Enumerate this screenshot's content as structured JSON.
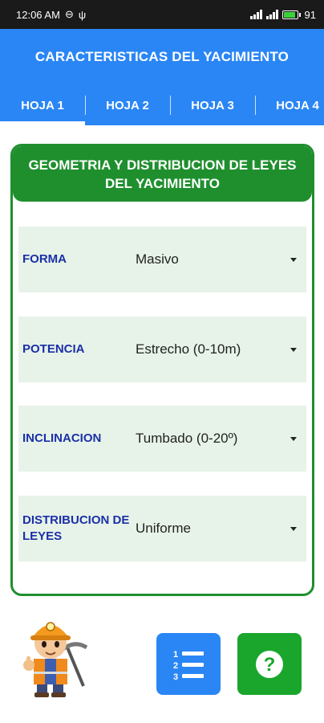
{
  "status_bar": {
    "time": "12:06 AM",
    "battery": "91"
  },
  "app_bar": {
    "title": "CARACTERISTICAS DEL YACIMIENTO"
  },
  "tabs": [
    {
      "label": "HOJA 1",
      "active": true
    },
    {
      "label": "HOJA 2",
      "active": false
    },
    {
      "label": "HOJA 3",
      "active": false
    },
    {
      "label": "HOJA 4",
      "active": false
    }
  ],
  "card": {
    "title": "GEOMETRIA Y DISTRIBUCION DE LEYES DEL YACIMIENTO",
    "rows": [
      {
        "label": "FORMA",
        "value": "Masivo"
      },
      {
        "label": "POTENCIA",
        "value": "Estrecho (0-10m)"
      },
      {
        "label": "INCLINACION",
        "value": "Tumbado (0-20º)"
      },
      {
        "label": "DISTRIBUCION DE LEYES",
        "value": "Uniforme"
      }
    ]
  },
  "buttons": {
    "list_icon": "numbered-list-icon",
    "help_icon": "question-mark-icon"
  },
  "colors": {
    "primary_blue": "#2a86f5",
    "primary_green": "#1f8f2e",
    "label_blue": "#1b2fa8",
    "row_bg": "#e7f3e8"
  }
}
